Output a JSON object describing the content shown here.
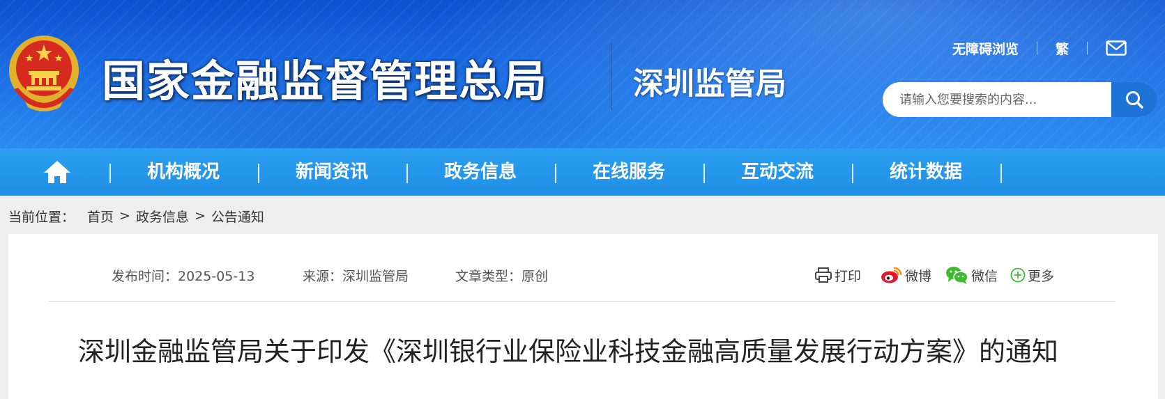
{
  "header": {
    "site_title": "国家金融监督管理总局",
    "sub_title": "深圳监管局",
    "links": {
      "accessibility": "无障碍浏览",
      "traditional": "繁"
    },
    "search": {
      "placeholder": "请输入您要搜索的内容..."
    },
    "colors": {
      "primary": "#1a6be3",
      "nav": "#2196ea"
    }
  },
  "nav": {
    "items": [
      "机构概况",
      "新闻资讯",
      "政务信息",
      "在线服务",
      "互动交流",
      "统计数据"
    ]
  },
  "breadcrumb": {
    "label": "当前位置：",
    "items": [
      "首页",
      "政务信息",
      "公告通知"
    ],
    "separator": ">"
  },
  "article": {
    "publish_time": "发布时间：2025-05-13",
    "source": "来源：深圳监管局",
    "type": "文章类型：原创",
    "share": {
      "print": "打印",
      "weibo": "微博",
      "wechat": "微信",
      "more": "更多"
    },
    "title": "深圳金融监管局关于印发《深圳银行业保险业科技金融高质量发展行动方案》的通知"
  },
  "icons": [
    "national-emblem-icon",
    "mail-icon",
    "search-icon",
    "home-icon",
    "print-icon",
    "weibo-icon",
    "wechat-icon",
    "plus-circle-icon"
  ]
}
